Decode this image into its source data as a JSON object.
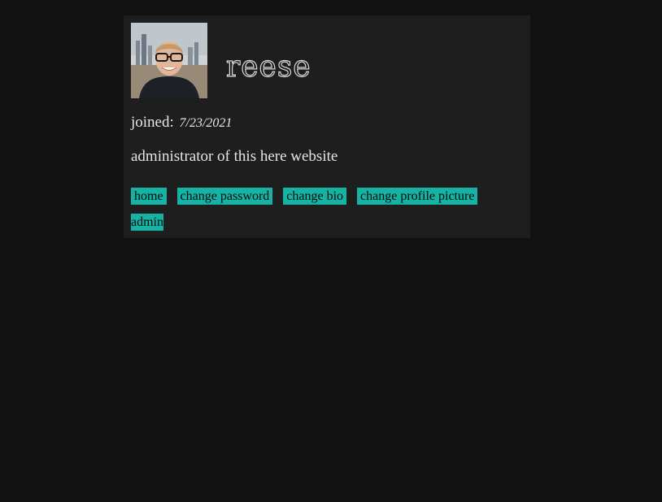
{
  "profile": {
    "username": "reese",
    "avatar_alt": "profile picture",
    "joined_label": "joined:",
    "joined_date": "7/23/2021",
    "bio": "administrator of this here website"
  },
  "links": [
    {
      "label": "home"
    },
    {
      "label": "change password"
    },
    {
      "label": "change bio"
    },
    {
      "label": "change profile picture"
    },
    {
      "label": "admin"
    }
  ],
  "colors": {
    "page_bg": "#121212",
    "card_bg": "#1e1e1e",
    "link_bg": "#16b3a5",
    "text": "#e6e6e6"
  }
}
